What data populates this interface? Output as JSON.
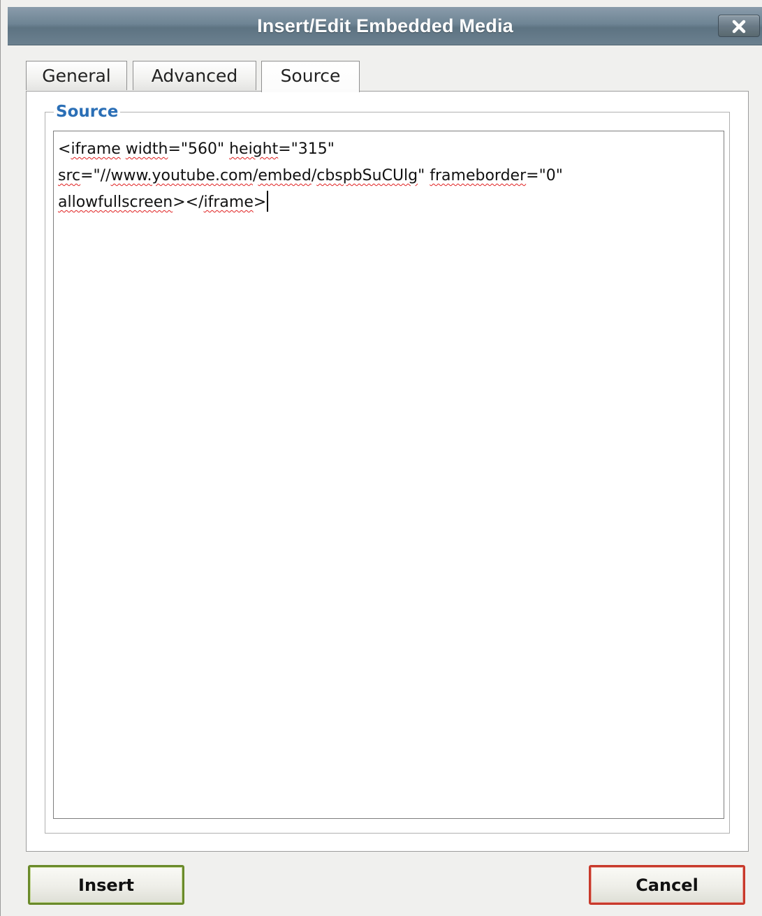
{
  "window": {
    "title": "Insert/Edit Embedded Media",
    "close_icon": "close-icon"
  },
  "tabs": [
    {
      "label": "General",
      "active": false
    },
    {
      "label": "Advanced",
      "active": false
    },
    {
      "label": "Source",
      "active": true
    }
  ],
  "source_panel": {
    "legend": "Source",
    "code_lines": [
      [
        {
          "text": "<",
          "sp": false
        },
        {
          "text": "iframe",
          "sp": true
        },
        {
          "text": " ",
          "sp": false
        },
        {
          "text": "width",
          "sp": true
        },
        {
          "text": "=\"560\" ",
          "sp": false
        },
        {
          "text": "height",
          "sp": true
        },
        {
          "text": "=\"315\"",
          "sp": false
        }
      ],
      [
        {
          "text": "src",
          "sp": true
        },
        {
          "text": "=\"//",
          "sp": false
        },
        {
          "text": "www.youtube.com",
          "sp": true
        },
        {
          "text": "/",
          "sp": false
        },
        {
          "text": "embed",
          "sp": true
        },
        {
          "text": "/",
          "sp": false
        },
        {
          "text": "cbspbSuCUlg",
          "sp": true
        },
        {
          "text": "\" ",
          "sp": false
        },
        {
          "text": "frameborder",
          "sp": true
        },
        {
          "text": "=\"0\"",
          "sp": false
        }
      ],
      [
        {
          "text": "allowfullscreen",
          "sp": true
        },
        {
          "text": "></",
          "sp": false
        },
        {
          "text": "iframe",
          "sp": true
        },
        {
          "text": ">",
          "sp": false
        }
      ]
    ],
    "spellcheck_underline_color": "#e02020"
  },
  "buttons": {
    "insert_label": "Insert",
    "cancel_label": "Cancel",
    "insert_border_color": "#6a8a2a",
    "cancel_border_color": "#c8392b"
  },
  "colors": {
    "title_bar": "#6e8494",
    "legend_text": "#2b6fb6",
    "dialog_background": "#f0f0ee"
  }
}
